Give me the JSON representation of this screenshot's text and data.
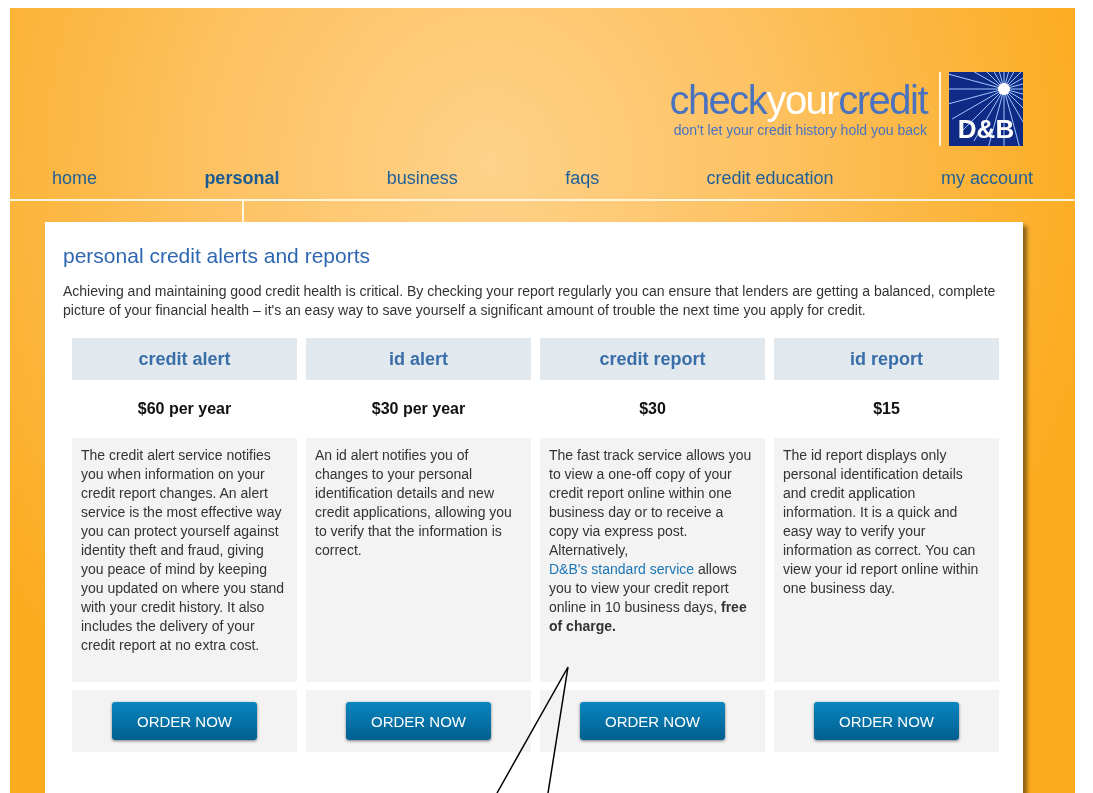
{
  "logo": {
    "brand_parts": [
      {
        "text": "check",
        "kind": "plain"
      },
      {
        "text": "your",
        "kind": "accent"
      },
      {
        "text": "credit",
        "kind": "plain"
      }
    ],
    "tagline": "don't let your credit history hold you back",
    "badge": "D&B"
  },
  "nav": [
    {
      "label": "home",
      "selected": false
    },
    {
      "label": "personal",
      "selected": true
    },
    {
      "label": "business",
      "selected": false
    },
    {
      "label": "faqs",
      "selected": false
    },
    {
      "label": "credit education",
      "selected": false
    },
    {
      "label": "my account",
      "selected": false
    }
  ],
  "page": {
    "title": "personal credit alerts and reports",
    "intro": "Achieving and maintaining good credit health is critical. By checking your report regularly you can ensure that lenders are getting a balanced, complete picture of your financial health – it's an easy way to save yourself a significant amount of trouble the next time you apply for credit."
  },
  "plans": [
    {
      "name": "credit alert",
      "price": "$60 per year",
      "description": "The credit alert service notifies you when information on your credit report changes. An alert service is the most effective way you can protect yourself against identity theft and fraud, giving you peace of mind by keeping you updated on where you stand with your credit history. It also includes the delivery of your credit report at no extra cost.",
      "button": "ORDER NOW"
    },
    {
      "name": "id alert",
      "price": "$30 per year",
      "description": "An id alert notifies you of changes to your personal identification details and new credit applications, allowing you to verify that the information is correct.",
      "button": "ORDER NOW"
    },
    {
      "name": "credit report",
      "price": "$30",
      "description": "The fast track service allows you to view a one-off copy of your credit report online within one business day or to receive a copy via express post. Alternatively, ",
      "link": "D&B's standard service",
      "description_after": " allows you to view your credit report online in 10 business days, **free of charge.**",
      "button": "ORDER NOW"
    },
    {
      "name": "id report",
      "price": "$15",
      "description": "The id report displays only personal identification details and credit application information. It is a quick and easy way to verify your information as correct. You can view your id report online within one business day.",
      "button": "ORDER NOW"
    }
  ]
}
